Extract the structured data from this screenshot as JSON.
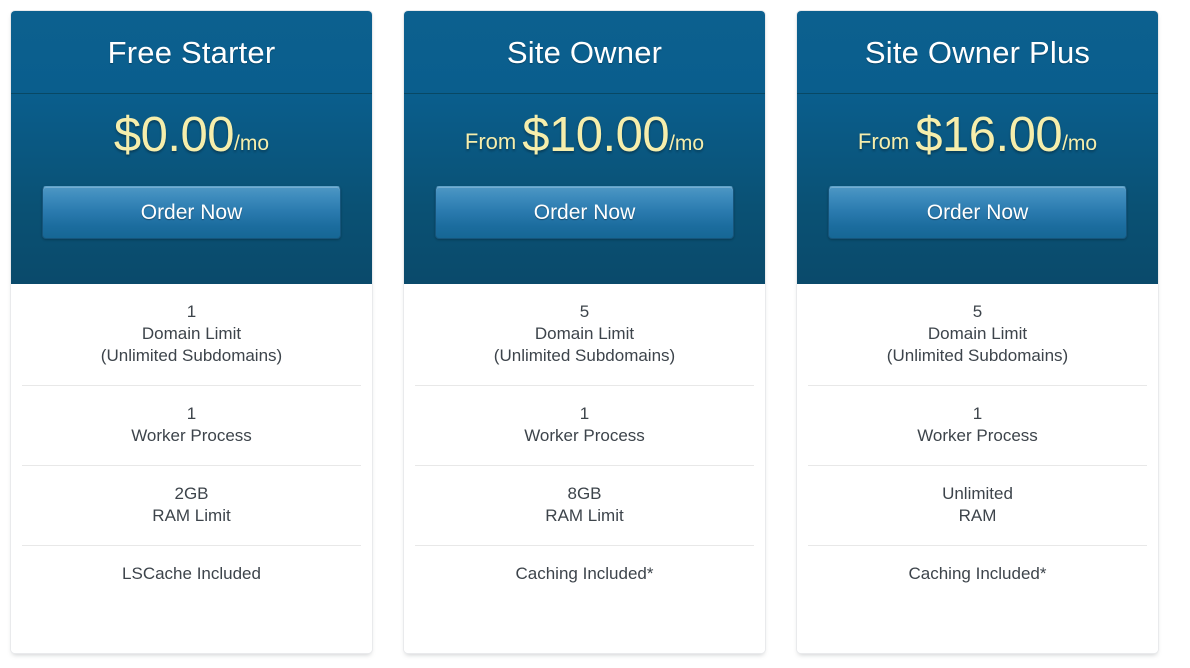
{
  "theme": {
    "header_blue_top": "#0c608f",
    "header_blue_bottom": "#0a4a6b",
    "price_yellow": "#f6eeac",
    "button_blue_top": "#4e97c4",
    "button_blue_bottom": "#166795",
    "feature_text": "#3d444b",
    "divider": "#e8e8e8",
    "card_border": "#e9eaec"
  },
  "plans": [
    {
      "name": "Free Starter",
      "price_prefix": "",
      "price_amount": "$0.00",
      "price_period": "/mo",
      "cta_label": "Order Now",
      "features": [
        [
          "1",
          "Domain Limit",
          "(Unlimited Subdomains)"
        ],
        [
          "1",
          "Worker Process"
        ],
        [
          "2GB",
          "RAM Limit"
        ],
        [
          "LSCache Included"
        ]
      ]
    },
    {
      "name": "Site Owner",
      "price_prefix": "From",
      "price_amount": "$10.00",
      "price_period": "/mo",
      "cta_label": "Order Now",
      "features": [
        [
          "5",
          "Domain Limit",
          "(Unlimited Subdomains)"
        ],
        [
          "1",
          "Worker Process"
        ],
        [
          "8GB",
          "RAM Limit"
        ],
        [
          "Caching Included*"
        ]
      ]
    },
    {
      "name": "Site Owner Plus",
      "price_prefix": "From",
      "price_amount": "$16.00",
      "price_period": "/mo",
      "cta_label": "Order Now",
      "features": [
        [
          "5",
          "Domain Limit",
          "(Unlimited Subdomains)"
        ],
        [
          "1",
          "Worker Process"
        ],
        [
          "Unlimited",
          "RAM"
        ],
        [
          "Caching Included*"
        ]
      ]
    }
  ]
}
